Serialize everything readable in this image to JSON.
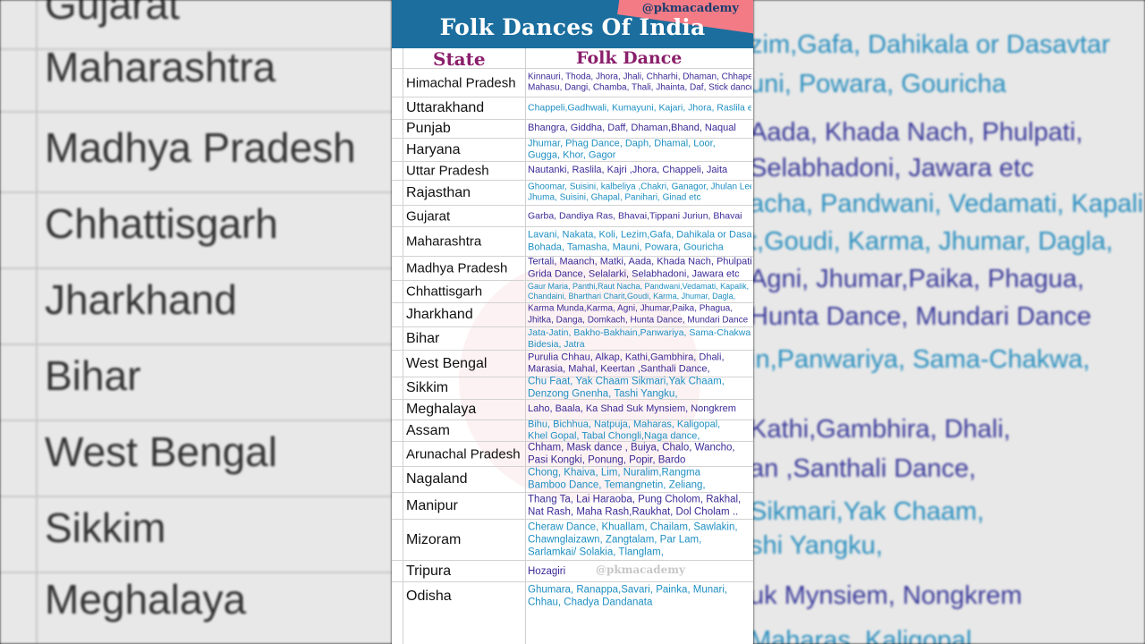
{
  "header": {
    "title": "Folk Dances Of India",
    "handle": "@pkmacademy"
  },
  "columns": {
    "state": "State",
    "dance": "Folk Dance"
  },
  "watermark": "@pkmacademy",
  "rows": [
    {
      "state": "Himachal Pradesh",
      "lines": [
        "Kinnauri, Thoda, Jhora, Jhali, Chharhi, Dhaman, Chhapeli,",
        "Mahasu, Dangi, Chamba, Thali, Jhainta, Daf, Stick dance"
      ],
      "color": "purple"
    },
    {
      "state": "Uttarakhand",
      "lines": [
        "Chappeli,Gadhwali, Kumayuni, Kajari, Jhora, Raslila etc"
      ],
      "color": "blue"
    },
    {
      "state": "Punjab",
      "lines": [
        "Bhangra, Giddha, Daff, Dhaman,Bhand, Naqual"
      ],
      "color": "purple"
    },
    {
      "state": "Haryana",
      "lines": [
        "Jhumar, Phag Dance, Daph, Dhamal, Loor,",
        "Gugga, Khor, Gagor"
      ],
      "color": "blue"
    },
    {
      "state": "Uttar Pradesh",
      "lines": [
        "Nautanki, Raslila, Kajri ,Jhora, Chappeli, Jaita"
      ],
      "color": "purple"
    },
    {
      "state": "Rajasthan",
      "lines": [
        "Ghoomar, Suisini, kalbeliya ,Chakri, Ganagor, Jhulan Leela,",
        "Jhuma, Suisini, Ghapal, Panihari, Ginad etc"
      ],
      "color": "blue"
    },
    {
      "state": "Gujarat",
      "lines": [
        "Garba, Dandiya Ras, Bhavai,Tippani Juriun, Bhavai"
      ],
      "color": "purple"
    },
    {
      "state": "Maharashtra",
      "lines": [
        "Lavani, Nakata, Koli, Lezim,Gafa, Dahikala or Dasavtar",
        "Bohada, Tamasha, Mauni, Powara, Gouricha"
      ],
      "color": "blue"
    },
    {
      "state": "Madhya Pradesh",
      "lines": [
        "Tertali, Maanch, Matki, Aada, Khada Nach, Phulpati,",
        "Grida Dance, Selalarki, Selabhadoni, Jawara etc"
      ],
      "color": "purple"
    },
    {
      "state": "Chhattisgarh",
      "lines": [
        "Gaur Maria, Panthi,Raut Nacha, Pandwani,Vedamati, Kapalik,",
        "Chandaini, Bharthari Charit,Goudi, Karma, Jhumar, Dagla,"
      ],
      "color": "blue"
    },
    {
      "state": "Jharkhand",
      "lines": [
        "Karma Munda,Karma, Agni, Jhumar,Paika, Phagua,",
        "Jhitka, Danga, Domkach, Hunta Dance, Mundari Dance"
      ],
      "color": "purple"
    },
    {
      "state": "Bihar",
      "lines": [
        "Jata-Jatin, Bakho-Bakhain,Panwariya, Sama-Chakwa,",
        "Bidesia, Jatra"
      ],
      "color": "blue"
    },
    {
      "state": "West Bengal",
      "lines": [
        "Purulia Chhau, Alkap, Kathi,Gambhira, Dhali,",
        "Marasia, Mahal, Keertan ,Santhali Dance,"
      ],
      "color": "purple"
    },
    {
      "state": "Sikkim",
      "lines": [
        "Chu Faat, Yak Chaam Sikmari,Yak Chaam,",
        "Denzong Gnenha, Tashi Yangku,"
      ],
      "color": "blue"
    },
    {
      "state": "Meghalaya",
      "lines": [
        "Laho, Baala, Ka Shad Suk  Mynsiem, Nongkrem"
      ],
      "color": "purple"
    },
    {
      "state": "Assam",
      "lines": [
        "Bihu, Bichhua, Natpuja, Maharas, Kaligopal,",
        "Khel Gopal, Tabal Chongli,Naga dance,"
      ],
      "color": "blue"
    },
    {
      "state": "Arunachal Pradesh",
      "lines": [
        "Chham, Mask dance , Buiya, Chalo, Wancho,",
        "Pasi Kongki, Ponung, Popir, Bardo"
      ],
      "color": "purple"
    },
    {
      "state": "Nagaland",
      "lines": [
        "Chong, Khaiva, Lim, Nuralim,Rangma",
        "Bamboo Dance, Temangnetin, Zeliang,"
      ],
      "color": "blue"
    },
    {
      "state": "Manipur",
      "lines": [
        "Thang Ta, Lai Haraoba, Pung Cholom, Rakhal,",
        "Nat Rash, Maha Rash,Raukhat, Dol Cholam .."
      ],
      "color": "purple"
    },
    {
      "state": "Mizoram",
      "lines": [
        "Cheraw Dance, Khuallam, Chailam, Sawlakin,",
        "Chawnglaizawn, Zangtalam, Par Lam,",
        "Sarlamkai/ Solakia, Tlanglam,"
      ],
      "color": "blue"
    },
    {
      "state": "Tripura",
      "lines": [
        "Hozagiri"
      ],
      "color": "purple"
    },
    {
      "state": "Odisha",
      "lines": [
        "Ghumara, Ranappa,Savari, Painka, Munari,",
        "Chhau, Chadya Dandanata"
      ],
      "color": "blue"
    }
  ],
  "background_left": [
    "Gujarat",
    "Maharashtra",
    "Madhya Pradesh",
    "Chhattisgarh",
    "Jharkhand",
    "Bihar",
    "West Bengal",
    "Sikkim",
    "Meghalaya"
  ],
  "background_right": [
    {
      "text": "",
      "color": "purple"
    },
    {
      "text": "zim,Gafa, Dahikala or Dasavtar",
      "color": "blue"
    },
    {
      "text": "uni, Powara, Gouricha",
      "color": "blue"
    },
    {
      "text": "Aada, Khada Nach, Phulpati,",
      "color": "purple"
    },
    {
      "text": "Selabhadoni, Jawara etc",
      "color": "purple"
    },
    {
      "text": "acha, Pandwani, Vedamati, Kapalik,",
      "color": "blue"
    },
    {
      "text": "t,Goudi, Karma, Jhumar, Dagla,",
      "color": "blue"
    },
    {
      "text": "Agni, Jhumar,Paika, Phagua,",
      "color": "purple"
    },
    {
      "text": "Hunta Dance, Mundari Dance",
      "color": "purple"
    },
    {
      "text": "in,Panwariya, Sama-Chakwa,",
      "color": "blue"
    },
    {
      "text": "Kathi,Gambhira, Dhali,",
      "color": "purple"
    },
    {
      "text": "an ,Santhali Dance,",
      "color": "purple"
    },
    {
      "text": "Sikmari,Yak Chaam,",
      "color": "blue"
    },
    {
      "text": "shi Yangku,",
      "color": "blue"
    },
    {
      "text": "uk  Mynsiem, Nongkrem",
      "color": "purple"
    },
    {
      "text": "Maharas, Kaligopal,",
      "color": "blue"
    }
  ]
}
